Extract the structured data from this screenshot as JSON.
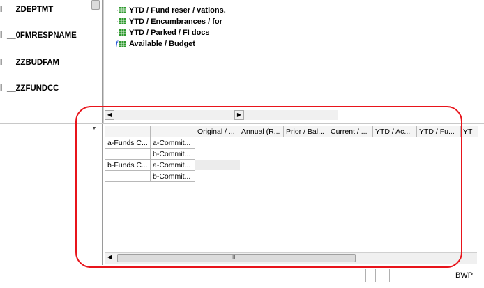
{
  "characteristics": [
    {
      "marker": "l",
      "name": "__ZDEPTMT"
    },
    {
      "marker": "l",
      "name": "__0FMRESPNAME"
    },
    {
      "marker": "l",
      "name": "__ZZBUDFAM"
    },
    {
      "marker": "l",
      "name": "__ZZFUNDCC"
    }
  ],
  "tree": [
    {
      "label": "YTD / Fund reser / vations.",
      "icon": "keyfigure-icon"
    },
    {
      "label": "YTD / Encumbrances / for",
      "icon": "keyfigure-icon"
    },
    {
      "label": "YTD / Parked  / FI docs",
      "icon": "keyfigure-icon"
    },
    {
      "label": "Available  /  Budget",
      "icon": "formula-icon"
    }
  ],
  "grid": {
    "columns": [
      "Original  / ...",
      "Annual (R...",
      "Prior / Bal...",
      "Current  / ...",
      "YTD  / Ac...",
      "YTD / Fu...",
      "YT"
    ],
    "rows": [
      [
        "a-Funds C...",
        "a-Commit..."
      ],
      [
        "",
        "b-Commit..."
      ],
      [
        "b-Funds C...",
        "a-Commit..."
      ],
      [
        "",
        "b-Commit..."
      ]
    ]
  },
  "status": {
    "system": "BWP"
  },
  "colors": {
    "annotation": "#e8141b",
    "keyfigure": "#1a8a1a",
    "formula": "#1e4fd6"
  },
  "scroll": {
    "hscroll_glyph": "III"
  }
}
